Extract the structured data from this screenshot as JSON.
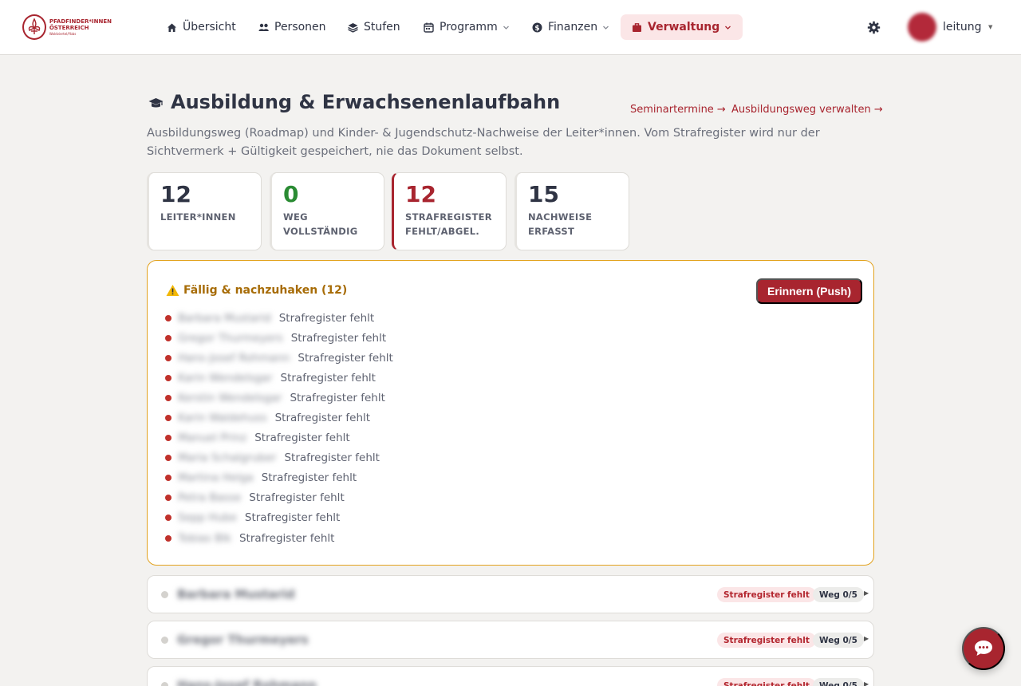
{
  "logo": {
    "line1": "PFADFINDER*INNEN",
    "line2": "ÖSTERREICH",
    "line3": "Waldviertel/Ybbs"
  },
  "nav": {
    "items": [
      {
        "label": "Übersicht",
        "icon": "home-icon"
      },
      {
        "label": "Personen",
        "icon": "people-icon"
      },
      {
        "label": "Stufen",
        "icon": "layers-icon"
      },
      {
        "label": "Programm",
        "icon": "calendar-icon"
      },
      {
        "label": "Finanzen",
        "icon": "dollar-icon"
      },
      {
        "label": "Verwaltung",
        "icon": "briefcase-icon"
      }
    ],
    "active": "Verwaltung",
    "username": "leitung"
  },
  "header": {
    "title": "Ausbildung & Erwachsenenlaufbahn",
    "link_seminar": "Seminartermine →",
    "link_roadmap": "Ausbildungsweg verwalten →",
    "subtitle": "Ausbildungsweg (Roadmap) und Kinder- & Jugendschutz-Nachweise der Leiter*innen. Vom Strafregister wird nur der Sichtvermerk + Gültigkeit gespeichert, nie das Dokument selbst."
  },
  "stats": [
    {
      "value": "12",
      "label_line1": "LEITER*INNEN",
      "label_line2": ""
    },
    {
      "value": "0",
      "label_line1": "WEG",
      "label_line2": "VOLLSTÄNDIG"
    },
    {
      "value": "12",
      "label_line1": "STRAFREGISTER",
      "label_line2": "FEHLT/ABGEL."
    },
    {
      "value": "15",
      "label_line1": "NACHWEISE",
      "label_line2": "ERFASST"
    }
  ],
  "due": {
    "title": "Fällig & nachzuhaken (12)",
    "remind_button": "Erinnern (Push)",
    "items": [
      {
        "name": "Barbara Mustarid",
        "reason": "Strafregister fehlt"
      },
      {
        "name": "Gregor Thurmeyers",
        "reason": "Strafregister fehlt"
      },
      {
        "name": "Hans-Josef Rohmann",
        "reason": "Strafregister fehlt"
      },
      {
        "name": "Karin Wendelsgar",
        "reason": "Strafregister fehlt"
      },
      {
        "name": "Kerstin Wendelsgar",
        "reason": "Strafregister fehlt"
      },
      {
        "name": "Karin Waldehuss",
        "reason": "Strafregister fehlt"
      },
      {
        "name": "Manuel Prinz",
        "reason": "Strafregister fehlt"
      },
      {
        "name": "Maria Schalgruber",
        "reason": "Strafregister fehlt"
      },
      {
        "name": "Martina Helga",
        "reason": "Strafregister fehlt"
      },
      {
        "name": "Petra Basse",
        "reason": "Strafregister fehlt"
      },
      {
        "name": "Sepp Hube",
        "reason": "Strafregister fehlt"
      },
      {
        "name": "Tobias Blk",
        "reason": "Strafregister fehlt"
      }
    ]
  },
  "people": [
    {
      "name": "Barbara Mustarid",
      "badge": "Strafregister fehlt",
      "progress": "Weg 0/5"
    },
    {
      "name": "Gregor Thurmeyers",
      "badge": "Strafregister fehlt",
      "progress": "Weg 0/5"
    },
    {
      "name": "Hans-Josef Rohmann",
      "badge": "Strafregister fehlt",
      "progress": "Weg 0/5"
    }
  ],
  "colors": {
    "brand": "#a8252f",
    "warning_border": "#e2a21e",
    "warning_text": "#a76c07",
    "success": "#2a8b33",
    "background": "#f3f2f0"
  }
}
